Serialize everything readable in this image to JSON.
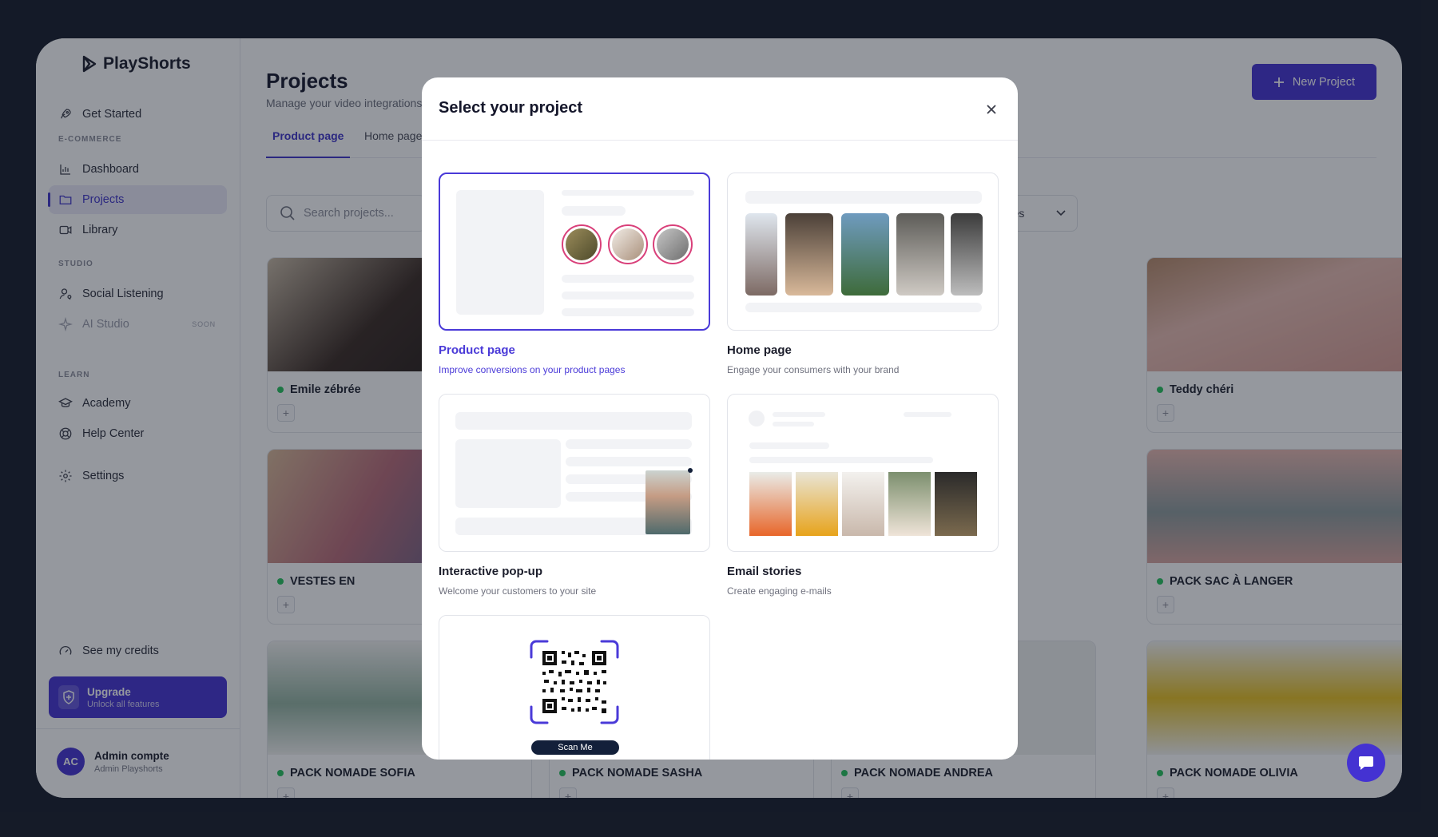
{
  "app": {
    "name": "PlayShorts"
  },
  "sidebar": {
    "get_started": "Get Started",
    "section_ecommerce": "E-COMMERCE",
    "dashboard": "Dashboard",
    "projects": "Projects",
    "library": "Library",
    "section_studio": "STUDIO",
    "social_listening": "Social Listening",
    "ai_studio": "AI Studio",
    "soon_badge": "SOON",
    "section_learn": "LEARN",
    "academy": "Academy",
    "help_center": "Help Center",
    "settings": "Settings",
    "credits": "See my credits",
    "upgrade_title": "Upgrade",
    "upgrade_sub": "Unlock all features",
    "account_initials": "AC",
    "account_name": "Admin compte",
    "account_org": "Admin Playshorts"
  },
  "main": {
    "title": "Projects",
    "subtitle": "Manage your video integrations",
    "new_project": "New Project",
    "tabs": [
      "Product page",
      "Home page"
    ],
    "search_placeholder": "Search projects...",
    "filter_label": "ages"
  },
  "projects": [
    {
      "name": "Emile zébrée",
      "color": "#2b2320"
    },
    {
      "name": "Teddy chéri",
      "color": "#d9a79c"
    },
    {
      "name": "VESTES EN",
      "color": "#c58a8e"
    },
    {
      "name": "PACK SAC À LANGER",
      "color": "#9aa6a8"
    },
    {
      "name": "PACK NOMADE SOFIA",
      "color": "#8fb09a"
    },
    {
      "name": "PACK NOMADE SASHA",
      "color": "#c9d0cc"
    },
    {
      "name": "PACK NOMADE ANDREA",
      "color": "#d9e2dc"
    },
    {
      "name": "PACK NOMADE OLIVIA",
      "color": "#e8c11c"
    }
  ],
  "modal": {
    "title": "Select your project",
    "options": [
      {
        "title": "Product page",
        "desc": "Improve conversions on your product pages"
      },
      {
        "title": "Home page",
        "desc": "Engage your consumers with your brand"
      },
      {
        "title": "Interactive pop-up",
        "desc": "Welcome your customers to your site"
      },
      {
        "title": "Email stories",
        "desc": "Create engaging e-mails"
      }
    ],
    "scan_label": "Scan Me"
  },
  "colors": {
    "accent": "#4432d2",
    "status_active": "#26c25c"
  }
}
